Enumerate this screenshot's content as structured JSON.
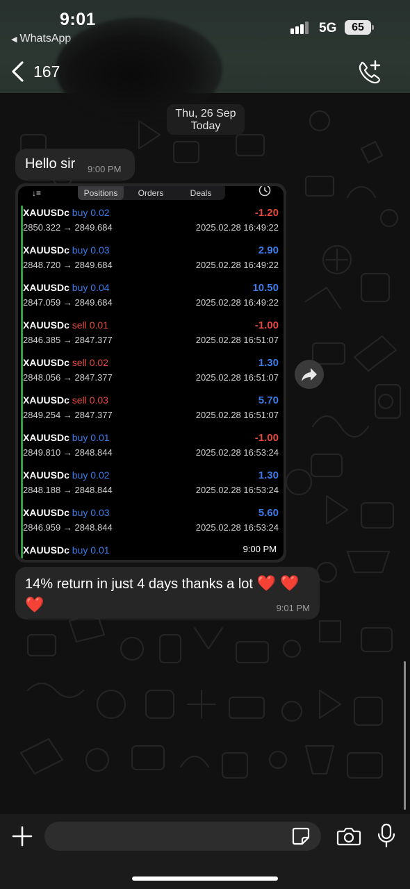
{
  "status": {
    "time": "9:01",
    "back_app": "WhatsApp",
    "network": "5G",
    "battery": "65"
  },
  "header": {
    "unread_count": "167"
  },
  "date_pill": {
    "line1": "Thu, 26 Sep",
    "line2": "Today"
  },
  "messages": {
    "greeting": {
      "text": "Hello sir",
      "time": "9:00 PM"
    },
    "image": {
      "time": "9:00 PM",
      "tabs": [
        "Positions",
        "Orders",
        "Deals"
      ],
      "active_tab": "Positions",
      "rows": [
        {
          "symbol": "XAUUSDc",
          "side": "buy",
          "volume": "0.02",
          "open": "2850.322",
          "current": "2849.684",
          "profit": "-1.20",
          "date": "2025.02.28 16:49:22"
        },
        {
          "symbol": "XAUUSDc",
          "side": "buy",
          "volume": "0.03",
          "open": "2848.720",
          "current": "2849.684",
          "profit": "2.90",
          "date": "2025.02.28 16:49:22"
        },
        {
          "symbol": "XAUUSDc",
          "side": "buy",
          "volume": "0.04",
          "open": "2847.059",
          "current": "2849.684",
          "profit": "10.50",
          "date": "2025.02.28 16:49:22"
        },
        {
          "symbol": "XAUUSDc",
          "side": "sell",
          "volume": "0.01",
          "open": "2846.385",
          "current": "2847.377",
          "profit": "-1.00",
          "date": "2025.02.28 16:51:07"
        },
        {
          "symbol": "XAUUSDc",
          "side": "sell",
          "volume": "0.02",
          "open": "2848.056",
          "current": "2847.377",
          "profit": "1.30",
          "date": "2025.02.28 16:51:07"
        },
        {
          "symbol": "XAUUSDc",
          "side": "sell",
          "volume": "0.03",
          "open": "2849.254",
          "current": "2847.377",
          "profit": "5.70",
          "date": "2025.02.28 16:51:07"
        },
        {
          "symbol": "XAUUSDc",
          "side": "buy",
          "volume": "0.01",
          "open": "2849.810",
          "current": "2848.844",
          "profit": "-1.00",
          "date": "2025.02.28 16:53:24"
        },
        {
          "symbol": "XAUUSDc",
          "side": "buy",
          "volume": "0.02",
          "open": "2848.188",
          "current": "2848.844",
          "profit": "1.30",
          "date": "2025.02.28 16:53:24"
        },
        {
          "symbol": "XAUUSDc",
          "side": "buy",
          "volume": "0.03",
          "open": "2846.959",
          "current": "2848.844",
          "profit": "5.60",
          "date": "2025.02.28 16:53:24"
        },
        {
          "symbol": "XAUUSDc",
          "side": "buy",
          "volume": "0.01",
          "open": "",
          "current": "",
          "profit": "",
          "date": ""
        }
      ]
    },
    "thanks": {
      "text": "14% return in just 4 days thanks a lot",
      "hearts": "❤️ ❤️ ❤️",
      "time": "9:01 PM"
    }
  },
  "composer": {
    "placeholder": ""
  },
  "colors": {
    "buy": "#3d7be8",
    "sell": "#e5483d",
    "bubble": "#262626",
    "header": "#2c3732"
  },
  "icons": [
    "back-chevron-icon",
    "add-call-icon",
    "forward-icon",
    "plus-icon",
    "sticker-icon",
    "camera-icon",
    "mic-icon",
    "clock-icon",
    "sort-icon"
  ]
}
